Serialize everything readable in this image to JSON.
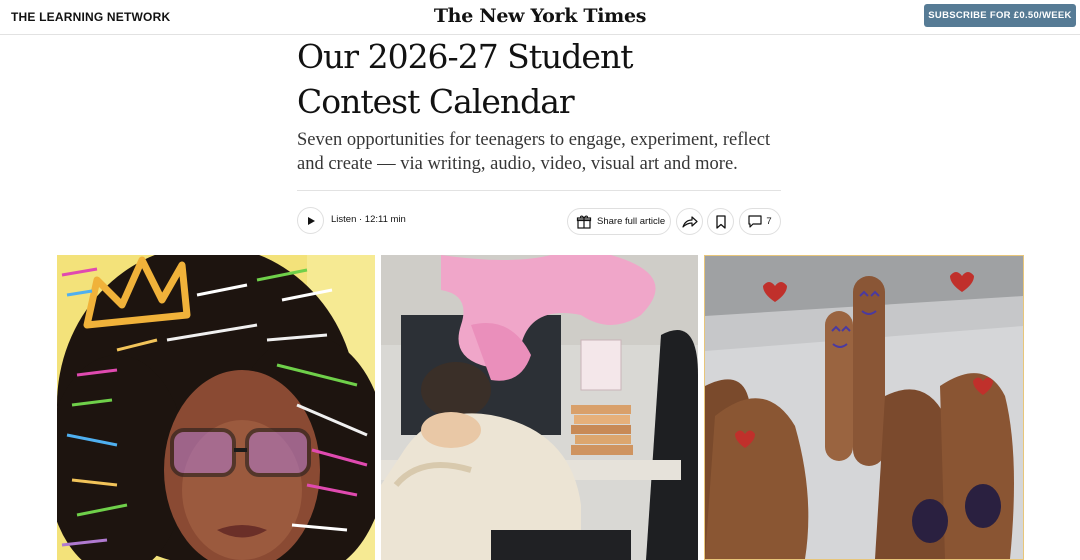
{
  "header": {
    "section_name": "THE LEARNING NETWORK",
    "masthead": "The New York Times",
    "subscribe_label": "SUBSCRIBE FOR £0.50/WEEK"
  },
  "article": {
    "headline_line1": "Our 2026-27 Student",
    "headline_line2": "Contest Calendar",
    "summary": "Seven opportunities for teenagers to engage, experiment, reflect and create — via writing, audio, video, visual art and more."
  },
  "actions": {
    "listen_label": "Listen · 12:11 min",
    "share_full_label": "Share full article",
    "comment_count": "7"
  },
  "images": [
    {
      "name": "illustration-girl-with-crown-and-words"
    },
    {
      "name": "illustration-student-at-desk-with-pink-smoke"
    },
    {
      "name": "photo-fingers-with-drawn-faces"
    }
  ],
  "icons": {
    "play": "play-icon",
    "gift": "gift-icon",
    "share": "share-arrow-icon",
    "bookmark": "bookmark-icon",
    "comment": "comment-icon"
  },
  "colors": {
    "subscribe_bg": "#567b95",
    "text": "#121212"
  }
}
